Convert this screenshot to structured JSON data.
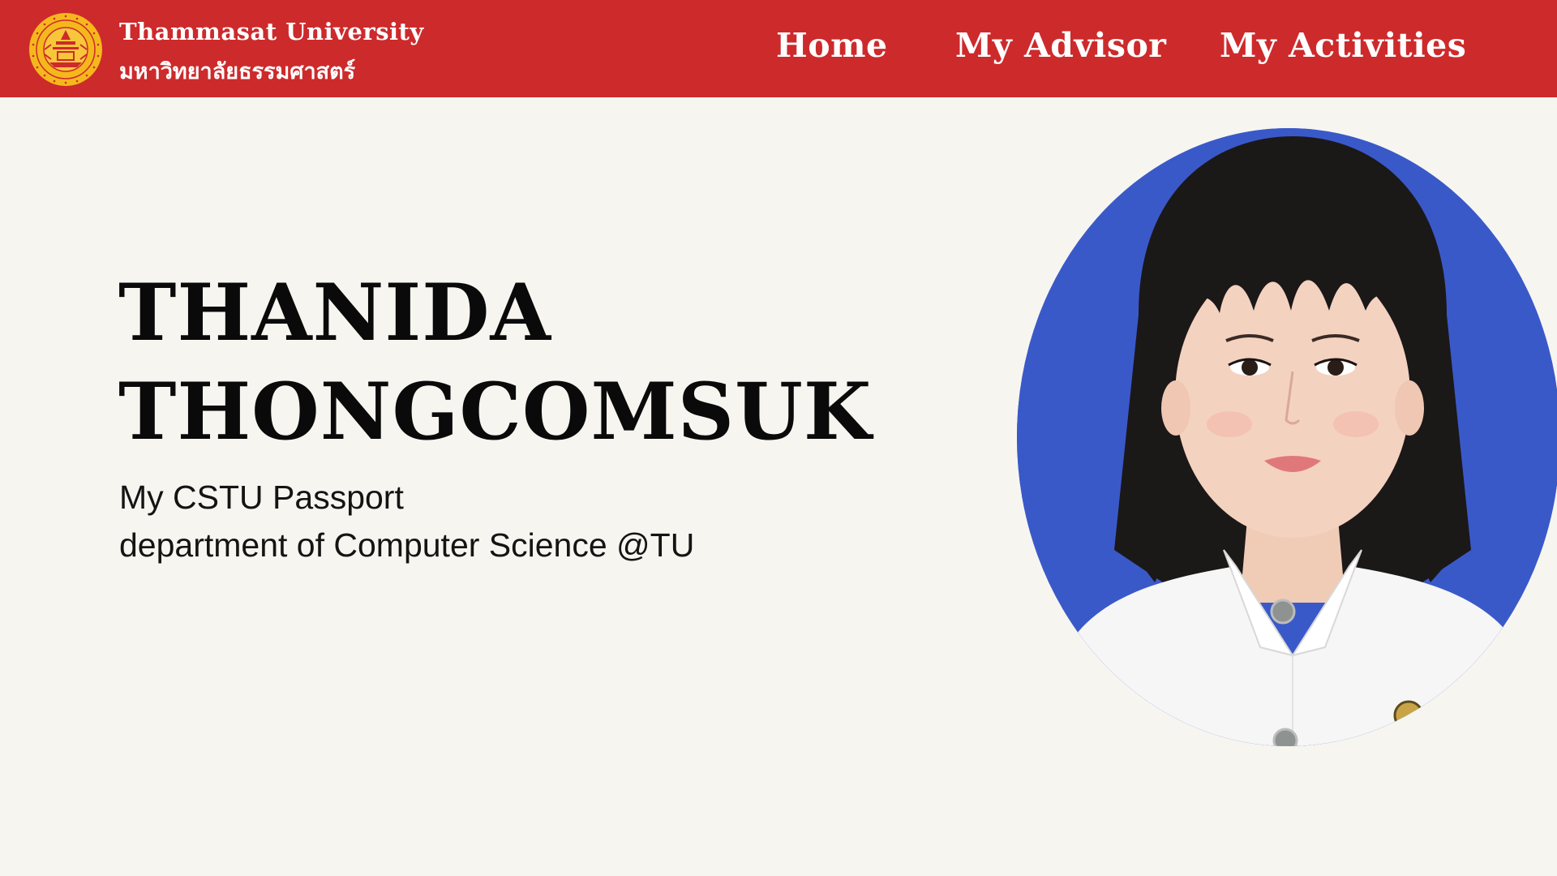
{
  "header": {
    "brand_en": "Thammasat University",
    "brand_th": "มหาวิทยาลัยธรรมศาสตร์",
    "logo_icon": "university-seal-icon",
    "logo_seal_top_text": "มหาวิทยาลัยธรรมศาสตร์",
    "logo_seal_bottom_text": "THAMMASAT UNIVERSITY",
    "nav": {
      "home": "Home",
      "advisor": "My Advisor",
      "activities": "My Activities"
    }
  },
  "profile": {
    "first_name": "THANIDA",
    "last_name": "THONGCOMSUK",
    "subtitle_1": "My CSTU Passport",
    "subtitle_2": "department of Computer Science @TU",
    "photo_icon": "student-portrait"
  },
  "colors": {
    "header_bg": "#cd2a2c",
    "page_bg": "#f6f5f0",
    "seal": "#f5b81c",
    "photo_bg": "#3a59c9"
  }
}
